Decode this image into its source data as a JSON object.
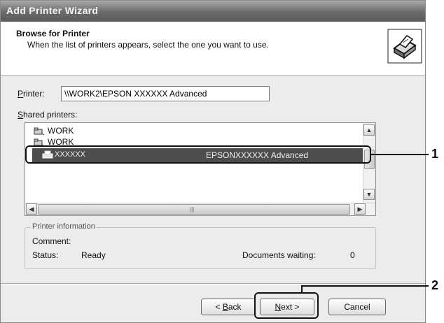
{
  "window": {
    "title": "Add Printer Wizard"
  },
  "header": {
    "title": "Browse for Printer",
    "subtitle": "When the list of printers appears, select the one you want to use."
  },
  "printer_field": {
    "label_accel": "P",
    "label_rest": "rinter:",
    "value": "\\\\WORK2\\EPSON XXXXXX Advanced"
  },
  "shared_printers": {
    "label_accel": "S",
    "label_rest": "hared printers:",
    "items": [
      {
        "name": "WORK",
        "icon": "network-folder-icon"
      },
      {
        "name": "WORK",
        "icon": "network-folder-icon"
      }
    ],
    "selected": {
      "name": "XXXXXX",
      "model": "EPSONXXXXXX Advanced",
      "icon": "printer-icon"
    }
  },
  "printer_info": {
    "legend": "Printer information",
    "comment_label": "Comment:",
    "comment_value": "",
    "status_label": "Status:",
    "status_value": "Ready",
    "docs_label": "Documents waiting:",
    "docs_value": "0"
  },
  "buttons": {
    "back_prefix": "< ",
    "back_accel": "B",
    "back_rest": "ack",
    "next_accel": "N",
    "next_rest": "ext >",
    "cancel": "Cancel"
  },
  "callouts": [
    "1",
    "2"
  ]
}
